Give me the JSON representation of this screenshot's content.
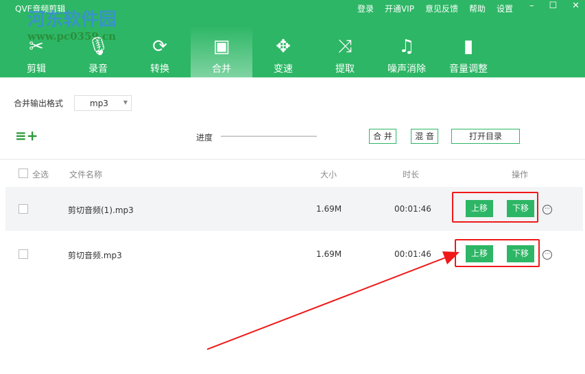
{
  "app": {
    "title": "QVE音频剪辑",
    "watermark": "河东软件园",
    "watermark_url": "www.pc0359.cn"
  },
  "menu": [
    "登录",
    "开通VIP",
    "意见反馈",
    "帮助",
    "设置"
  ],
  "nav": [
    {
      "label": "剪辑",
      "icon": "✂"
    },
    {
      "label": "录音",
      "icon": "🎙"
    },
    {
      "label": "转换",
      "icon": "⟳"
    },
    {
      "label": "合并",
      "icon": "▣"
    },
    {
      "label": "变速",
      "icon": "✥"
    },
    {
      "label": "提取",
      "icon": "⤨"
    },
    {
      "label": "噪声消除",
      "icon": "♫"
    },
    {
      "label": "音量调整",
      "icon": "▮"
    }
  ],
  "format": {
    "label": "合并输出格式",
    "value": "mp3"
  },
  "progress": {
    "label": "进度",
    "value": 0
  },
  "buttons": {
    "merge": "合 并",
    "mix": "混 音",
    "open_dir": "打开目录"
  },
  "table": {
    "select_all": "全选",
    "headers": [
      "文件名称",
      "大小",
      "时长",
      "操作"
    ],
    "rows": [
      {
        "name": "剪切音频(1).mp3",
        "size": "1.69M",
        "duration": "00:01:46"
      },
      {
        "name": "剪切音频.mp3",
        "size": "1.69M",
        "duration": "00:01:46"
      }
    ],
    "up": "上移",
    "down": "下移"
  }
}
